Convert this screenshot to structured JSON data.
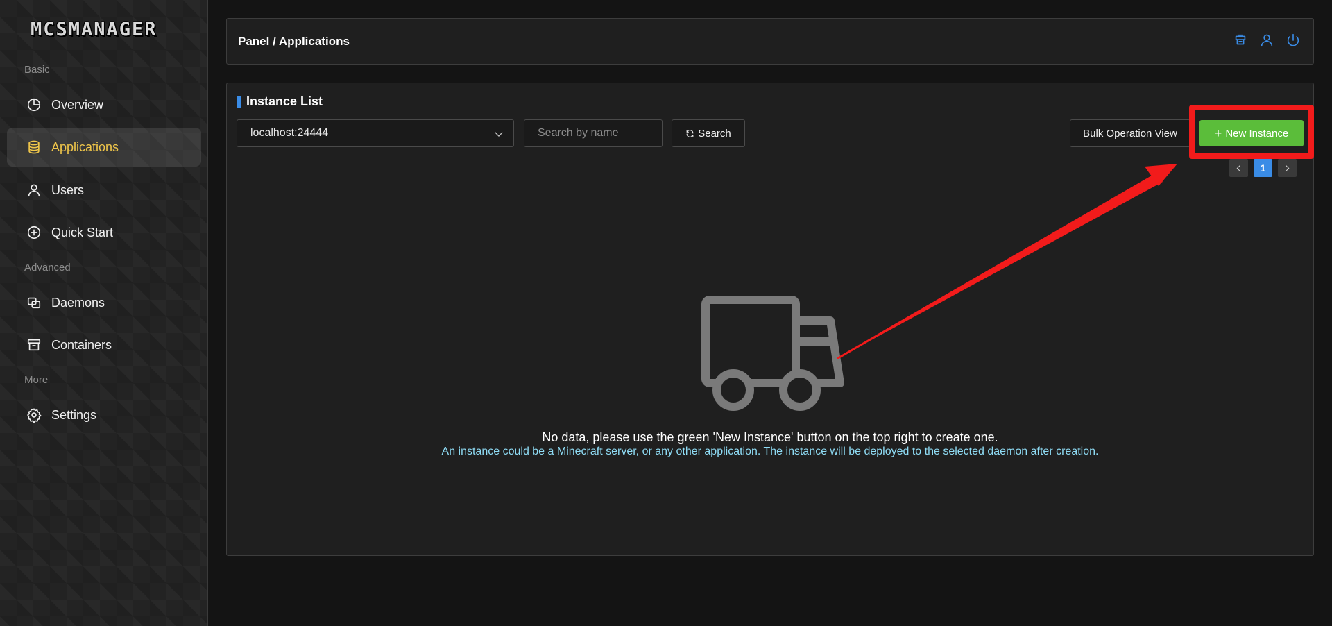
{
  "app": {
    "logo_text": "MCSMANAGER"
  },
  "sidebar": {
    "groups": [
      {
        "label": "Basic"
      },
      {
        "label": "Advanced"
      },
      {
        "label": "More"
      }
    ],
    "items": [
      {
        "label": "Overview",
        "icon": "pie-chart-icon"
      },
      {
        "label": "Applications",
        "icon": "database-icon",
        "active": true
      },
      {
        "label": "Users",
        "icon": "user-icon"
      },
      {
        "label": "Quick Start",
        "icon": "plus-circle-icon"
      },
      {
        "label": "Daemons",
        "icon": "block-icon"
      },
      {
        "label": "Containers",
        "icon": "container-icon"
      },
      {
        "label": "Settings",
        "icon": "gear-icon"
      }
    ]
  },
  "header": {
    "breadcrumb": "Panel / Applications",
    "icons": [
      "notification-icon",
      "user-icon",
      "power-icon"
    ]
  },
  "card": {
    "title": "Instance List",
    "daemon_select": {
      "value": "localhost:24444"
    },
    "search": {
      "placeholder": "Search by name",
      "button_label": "Search"
    },
    "bulk_button_label": "Bulk Operation View",
    "new_button_label": "New Instance",
    "pagination": {
      "current_page": "1"
    },
    "empty": {
      "message": "No data, please use the green 'New Instance' button on the top right to create one.",
      "hint": "An instance could be a Minecraft server, or any other application. The instance will be deployed to the selected daemon after creation."
    }
  },
  "colors": {
    "accent": "#3a8ce6",
    "active_nav": "#f0c64a",
    "new_button": "#5bbd3a",
    "annotation_red": "#f21b1b",
    "hint_text": "#8fdcf5"
  }
}
